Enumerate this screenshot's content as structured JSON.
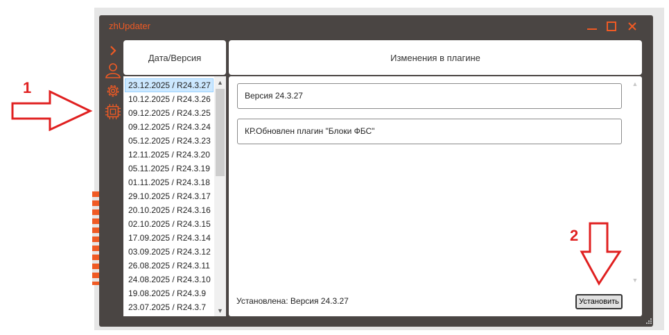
{
  "window": {
    "title": "zhUpdater",
    "accent_color": "#f05a24",
    "background_color": "#4a4543"
  },
  "title_bar_buttons": [
    "minimize-icon",
    "maximize-icon",
    "close-icon"
  ],
  "sidebar_icons": [
    "chevron-right-icon",
    "user-icon",
    "gear-icon",
    "chip-icon"
  ],
  "columns": {
    "date_version_header": "Дата/Версия",
    "changes_header": "Изменения в плагине"
  },
  "versions": [
    "23.12.2025 / R24.3.27",
    "10.12.2025 / R24.3.26",
    "09.12.2025 / R24.3.25",
    "09.12.2025 / R24.3.24",
    "05.12.2025 / R24.3.23",
    "12.11.2025 / R24.3.20",
    "05.11.2025 / R24.3.19",
    "01.11.2025 / R24.3.18",
    "29.10.2025 / R24.3.17",
    "20.10.2025 / R24.3.16",
    "02.10.2025 / R24.3.15",
    "17.09.2025 / R24.3.14",
    "03.09.2025 / R24.3.12",
    "26.08.2025 / R24.3.11",
    "24.08.2025 / R24.3.10",
    "19.08.2025 / R24.3.9",
    "23.07.2025 / R24.3.7"
  ],
  "selected_version": "23.12.2025 / R24.3.27",
  "changes": [
    "Версия 24.3.27",
    "КР.Обновлен плагин \"Блоки ФБС\""
  ],
  "footer": {
    "installed_text": "Установлена: Версия 24.3.27",
    "install_button": "Установить"
  },
  "annotations": {
    "marker_1": "1",
    "marker_2": "2",
    "color": "#e02020"
  }
}
